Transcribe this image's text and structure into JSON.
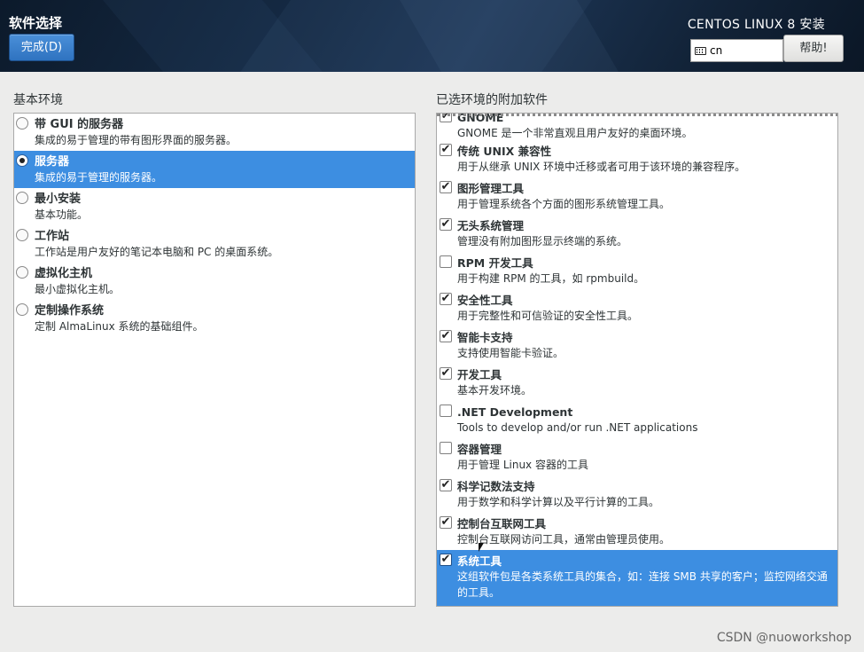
{
  "header": {
    "page_title": "软件选择",
    "done_label": "完成(D)",
    "product_title": "CENTOS LINUX 8 安装",
    "keyboard_layout": "cn",
    "help_label": "帮助!"
  },
  "base_env": {
    "heading": "基本环境",
    "items": [
      {
        "title": "带 GUI 的服务器",
        "desc": "集成的易于管理的带有图形界面的服务器。",
        "selected": false
      },
      {
        "title": "服务器",
        "desc": "集成的易于管理的服务器。",
        "selected": true
      },
      {
        "title": "最小安装",
        "desc": "基本功能。",
        "selected": false
      },
      {
        "title": "工作站",
        "desc": "工作站是用户友好的笔记本电脑和 PC 的桌面系统。",
        "selected": false
      },
      {
        "title": "虚拟化主机",
        "desc": "最小虚拟化主机。",
        "selected": false
      },
      {
        "title": "定制操作系统",
        "desc": "定制 AlmaLinux 系统的基础组件。",
        "selected": false
      }
    ]
  },
  "addons": {
    "heading": "已选环境的附加软件",
    "items": [
      {
        "title": "GNOME",
        "desc": "GNOME 是一个非常直观且用户友好的桌面环境。",
        "checked": true
      },
      {
        "title": "传统 UNIX 兼容性",
        "desc": "用于从继承 UNIX 环境中迁移或者可用于该环境的兼容程序。",
        "checked": true
      },
      {
        "title": "图形管理工具",
        "desc": "用于管理系统各个方面的图形系统管理工具。",
        "checked": true
      },
      {
        "title": "无头系统管理",
        "desc": "管理没有附加图形显示终端的系统。",
        "checked": true
      },
      {
        "title": "RPM 开发工具",
        "desc": "用于构建 RPM 的工具，如 rpmbuild。",
        "checked": false
      },
      {
        "title": "安全性工具",
        "desc": "用于完整性和可信验证的安全性工具。",
        "checked": true
      },
      {
        "title": "智能卡支持",
        "desc": "支持使用智能卡验证。",
        "checked": true
      },
      {
        "title": "开发工具",
        "desc": "基本开发环境。",
        "checked": true
      },
      {
        "title": ".NET Development",
        "desc": "Tools to develop and/or run .NET applications",
        "checked": false
      },
      {
        "title": "容器管理",
        "desc": "用于管理 Linux 容器的工具",
        "checked": false
      },
      {
        "title": "科学记数法支持",
        "desc": "用于数学和科学计算以及平行计算的工具。",
        "checked": true
      },
      {
        "title": "控制台互联网工具",
        "desc": "控制台互联网访问工具，通常由管理员使用。",
        "checked": true
      },
      {
        "title": "系统工具",
        "desc": "这组软件包是各类系统工具的集合，如：连接 SMB 共享的客户；监控网络交通的工具。",
        "checked": true,
        "selected": true
      }
    ]
  },
  "watermark": "CSDN @nuoworkshop",
  "colors": {
    "accent": "#3d8ee1",
    "header_bg": "#152a44"
  }
}
